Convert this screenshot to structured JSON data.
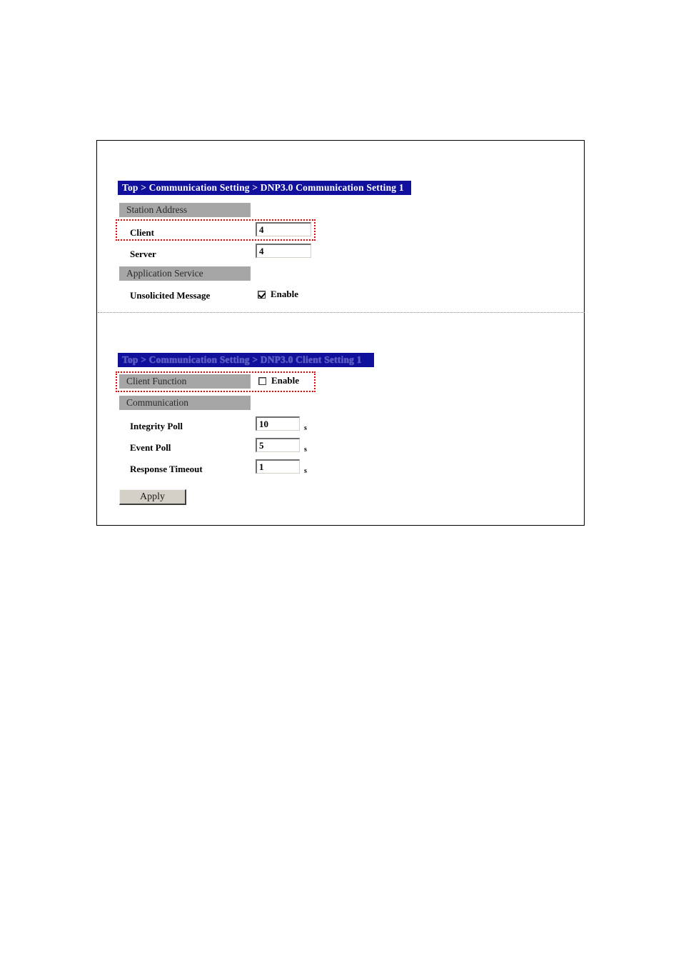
{
  "panels": [
    {
      "id": "dnp3-communication-setting",
      "titlebar": "Top > Communication Setting > DNP3.0 Communication Setting 1",
      "sections": [
        {
          "header": "Station Address",
          "rows": [
            {
              "label": "Client",
              "value": "4",
              "highlighted": true
            },
            {
              "label": "Server",
              "value": "4",
              "highlighted": false
            }
          ]
        },
        {
          "header": "Application Service",
          "rows": [
            {
              "label": "Unsolicited Message",
              "checkbox_label": "Enable",
              "checked": true
            }
          ]
        }
      ]
    },
    {
      "id": "dnp3-client-setting",
      "titlebar": "Top > Communication Setting > DNP3.0 Client Setting 1",
      "sections": [
        {
          "header": "Client Function",
          "checkbox_label": "Enable",
          "checked": false,
          "highlighted": true
        },
        {
          "header": "Communication",
          "rows": [
            {
              "label": "Integrity Poll",
              "value": "10",
              "unit": "s"
            },
            {
              "label": "Event Poll",
              "value": "5",
              "unit": "s"
            },
            {
              "label": "Response Timeout",
              "value": "1",
              "unit": "s"
            }
          ]
        }
      ],
      "apply_label": "Apply"
    }
  ],
  "colors": {
    "titlebar_bg": "#10109c",
    "section_bg": "#a6a6a6",
    "highlight": "#ee0000",
    "button_face": "#d4d0c8"
  }
}
